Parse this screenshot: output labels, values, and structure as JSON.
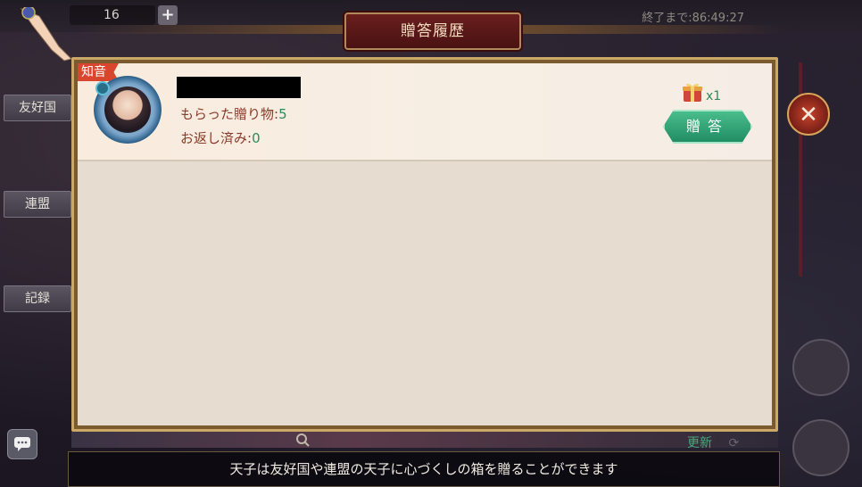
{
  "header": {
    "title": "贈答履歴",
    "counter_value": "16",
    "timer_text": "終了まで:86:49:27"
  },
  "sidebar": {
    "items": [
      {
        "label": "友好国"
      },
      {
        "label": "連盟"
      },
      {
        "label": "記録"
      }
    ]
  },
  "record": {
    "badge": "知音",
    "received_label": "もらった贈り物:",
    "received_value": "5",
    "returned_label": "お返し済み:",
    "returned_value": "0",
    "gift_count": "x1",
    "reply_button": "贈答"
  },
  "footer": {
    "refresh_label": "更新",
    "notice": "天子は友好国や連盟の天子に心づくしの箱を贈ることができます"
  },
  "icons": {
    "close": "close-icon",
    "chat": "chat-icon",
    "gift": "gift-box-icon",
    "search": "search-icon",
    "refresh": "refresh-icon"
  },
  "colors": {
    "badge": "#d8462e",
    "accent_green": "#2e8a5a",
    "label_red": "#8a3a28",
    "title_plate": "#6a1e1e"
  }
}
